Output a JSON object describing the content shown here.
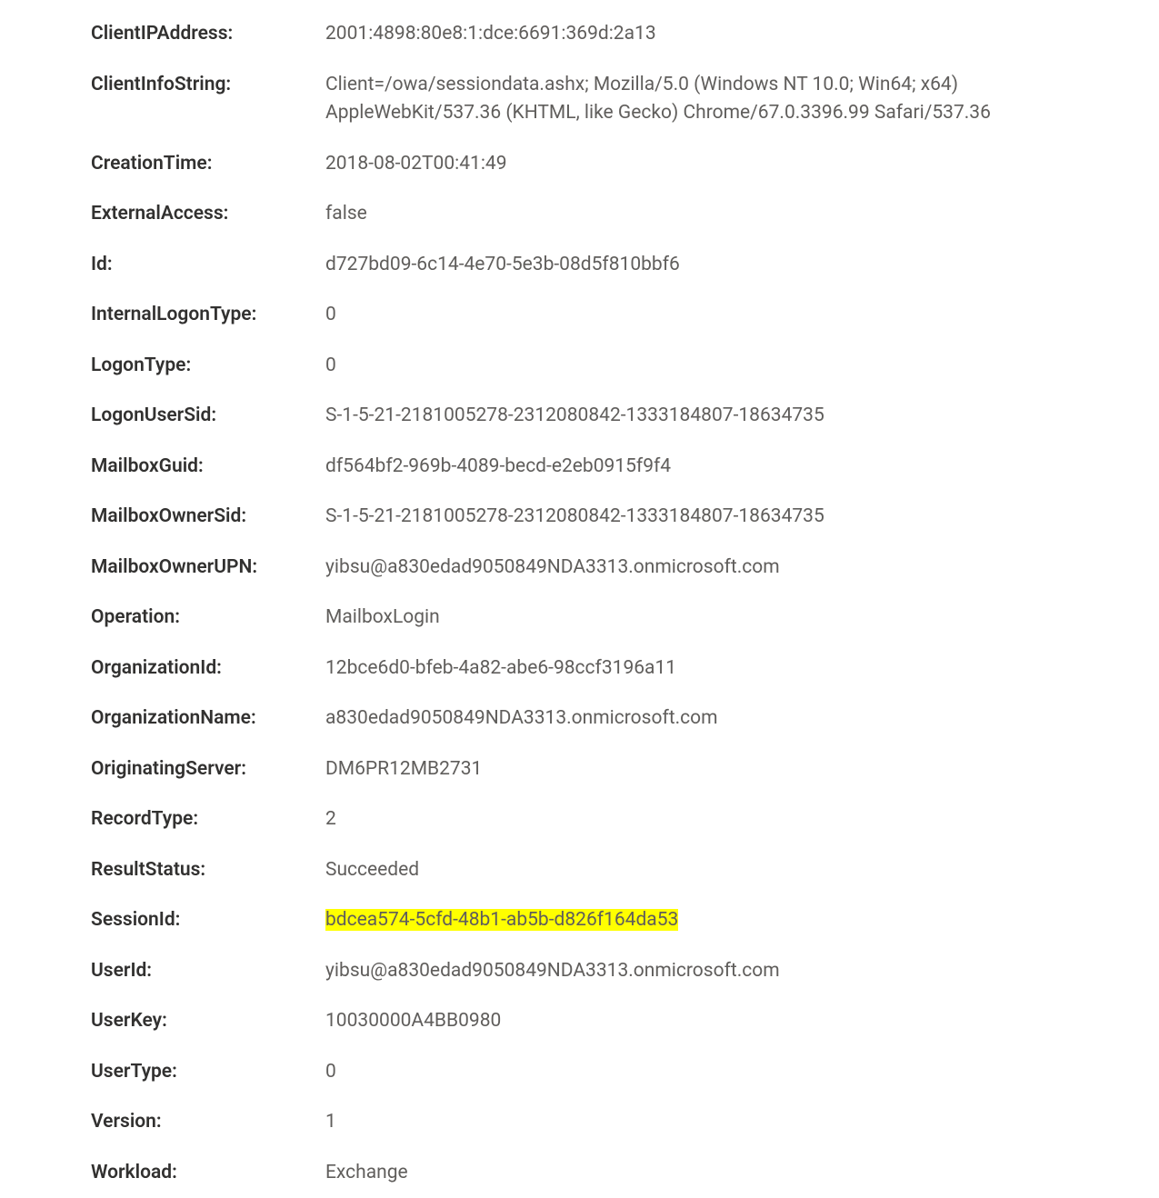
{
  "properties": [
    {
      "label": "ClientIPAddress:",
      "value": "2001:4898:80e8:1:dce:6691:369d:2a13",
      "highlighted": false
    },
    {
      "label": "ClientInfoString:",
      "value": "Client=/owa/sessiondata.ashx; Mozilla/5.0 (Windows NT 10.0; Win64; x64) AppleWebKit/537.36 (KHTML, like Gecko) Chrome/67.0.3396.99 Safari/537.36",
      "highlighted": false
    },
    {
      "label": "CreationTime:",
      "value": "2018-08-02T00:41:49",
      "highlighted": false
    },
    {
      "label": "ExternalAccess:",
      "value": "false",
      "highlighted": false
    },
    {
      "label": "Id:",
      "value": "d727bd09-6c14-4e70-5e3b-08d5f810bbf6",
      "highlighted": false
    },
    {
      "label": "InternalLogonType:",
      "value": "0",
      "highlighted": false
    },
    {
      "label": "LogonType:",
      "value": "0",
      "highlighted": false
    },
    {
      "label": "LogonUserSid:",
      "value": "S-1-5-21-2181005278-2312080842-1333184807-18634735",
      "highlighted": false
    },
    {
      "label": "MailboxGuid:",
      "value": "df564bf2-969b-4089-becd-e2eb0915f9f4",
      "highlighted": false
    },
    {
      "label": "MailboxOwnerSid:",
      "value": "S-1-5-21-2181005278-2312080842-1333184807-18634735",
      "highlighted": false
    },
    {
      "label": "MailboxOwnerUPN:",
      "value": "yibsu@a830edad9050849NDA3313.onmicrosoft.com",
      "highlighted": false
    },
    {
      "label": "Operation:",
      "value": "MailboxLogin",
      "highlighted": false
    },
    {
      "label": "OrganizationId:",
      "value": "12bce6d0-bfeb-4a82-abe6-98ccf3196a11",
      "highlighted": false
    },
    {
      "label": "OrganizationName:",
      "value": "a830edad9050849NDA3313.onmicrosoft.com",
      "highlighted": false
    },
    {
      "label": "OriginatingServer:",
      "value": "DM6PR12MB2731",
      "highlighted": false
    },
    {
      "label": "RecordType:",
      "value": "2",
      "highlighted": false
    },
    {
      "label": "ResultStatus:",
      "value": "Succeeded",
      "highlighted": false
    },
    {
      "label": "SessionId:",
      "value": "bdcea574-5cfd-48b1-ab5b-d826f164da53",
      "highlighted": true
    },
    {
      "label": "UserId:",
      "value": "yibsu@a830edad9050849NDA3313.onmicrosoft.com",
      "highlighted": false
    },
    {
      "label": "UserKey:",
      "value": "10030000A4BB0980",
      "highlighted": false
    },
    {
      "label": "UserType:",
      "value": "0",
      "highlighted": false
    },
    {
      "label": "Version:",
      "value": "1",
      "highlighted": false
    },
    {
      "label": "Workload:",
      "value": "Exchange",
      "highlighted": false
    }
  ]
}
